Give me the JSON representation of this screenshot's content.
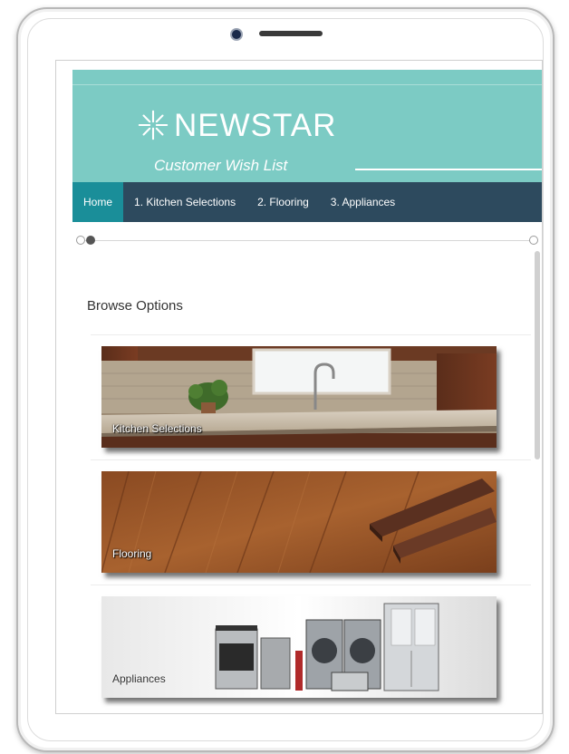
{
  "brand": {
    "name": "NEWSTAR",
    "tagline": "Customer Wish List"
  },
  "nav": {
    "items": [
      {
        "label": "Home",
        "active": true
      },
      {
        "label": "1. Kitchen Selections",
        "active": false
      },
      {
        "label": "2. Flooring",
        "active": false
      },
      {
        "label": "3. Appliances",
        "active": false
      }
    ]
  },
  "main": {
    "heading": "Browse Options",
    "cards": [
      {
        "label": "Kitchen Selections",
        "image": "kitchen-photo"
      },
      {
        "label": "Flooring",
        "image": "wood-floor-photo"
      },
      {
        "label": "Appliances",
        "image": "appliances-photo"
      }
    ]
  },
  "colors": {
    "header_bg": "#7ccbc4",
    "nav_bg": "#2d4a5e",
    "nav_active_bg": "#1a8e99"
  },
  "icons": [
    "newstar-logo-icon",
    "camera-icon",
    "speaker-icon"
  ]
}
